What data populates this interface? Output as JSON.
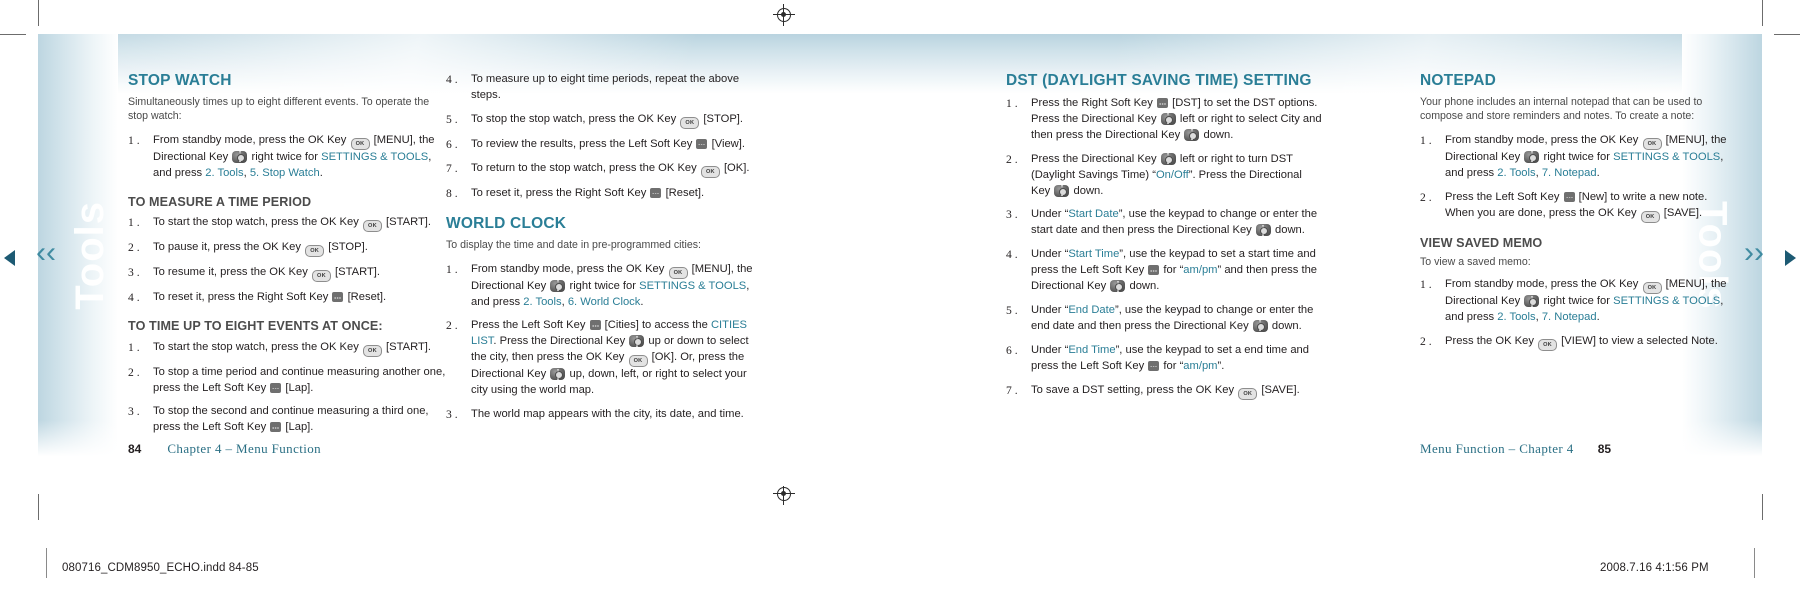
{
  "document": {
    "left_page_number": "84",
    "right_page_number": "85",
    "left_footer_text": "Chapter 4 – Menu Function",
    "right_footer_text": "Menu Function – Chapter 4",
    "slug_left": "080716_CDM8950_ECHO.indd   84-85",
    "slug_right": "2008.7.16   4:1:56 PM",
    "thumb_tab_label": "Tools",
    "accent_color": "#2a7e96",
    "body_color": "#231f20"
  },
  "icons": {
    "ok_key": "ok-key-icon",
    "soft_key": "soft-key-icon",
    "directional_key": "directional-key-icon",
    "registration_mark": "registration-mark-icon",
    "ok_label": "OK"
  },
  "columns": {
    "col1": {
      "section_title": "STOP WATCH",
      "intro": "Simultaneously times up to eight different events. To operate the stop watch:",
      "steps": [
        {
          "num": "1 .",
          "parts": [
            {
              "t": "text",
              "v": "From standby mode, press the OK Key "
            },
            {
              "t": "ok"
            },
            {
              "t": "text",
              "v": " [MENU], the Directional Key "
            },
            {
              "t": "dir"
            },
            {
              "t": "text",
              "v": " right twice for "
            },
            {
              "t": "link",
              "v": "SETTINGS & TOOLS"
            },
            {
              "t": "text",
              "v": ", and press "
            },
            {
              "t": "link",
              "v": "2. Tools"
            },
            {
              "t": "text",
              "v": ", "
            },
            {
              "t": "link",
              "v": "5. Stop Watch"
            },
            {
              "t": "text",
              "v": "."
            }
          ]
        }
      ],
      "sub1_title": "TO MEASURE A TIME PERIOD",
      "sub1_steps": [
        {
          "num": "1 .",
          "parts": [
            {
              "t": "text",
              "v": "To start the stop watch, press the OK Key "
            },
            {
              "t": "ok"
            },
            {
              "t": "text",
              "v": " [START]."
            }
          ]
        },
        {
          "num": "2 .",
          "parts": [
            {
              "t": "text",
              "v": "To pause it, press the OK Key "
            },
            {
              "t": "ok"
            },
            {
              "t": "text",
              "v": " [STOP]."
            }
          ]
        },
        {
          "num": "3 .",
          "parts": [
            {
              "t": "text",
              "v": "To resume it, press the OK Key "
            },
            {
              "t": "ok"
            },
            {
              "t": "text",
              "v": " [START]."
            }
          ]
        },
        {
          "num": "4 .",
          "parts": [
            {
              "t": "text",
              "v": "To reset it, press the Right Soft Key "
            },
            {
              "t": "soft"
            },
            {
              "t": "text",
              "v": " [Reset]."
            }
          ]
        }
      ],
      "sub2_title": "TO TIME UP TO EIGHT EVENTS AT ONCE:",
      "sub2_steps": [
        {
          "num": "1 .",
          "parts": [
            {
              "t": "text",
              "v": "To start the stop watch, press the OK Key "
            },
            {
              "t": "ok"
            },
            {
              "t": "text",
              "v": " [START]."
            }
          ]
        },
        {
          "num": "2 .",
          "parts": [
            {
              "t": "text",
              "v": "To stop a time period and continue measuring another one, press the Left Soft Key "
            },
            {
              "t": "soft"
            },
            {
              "t": "text",
              "v": " [Lap]."
            }
          ]
        },
        {
          "num": "3 .",
          "parts": [
            {
              "t": "text",
              "v": "To stop the second and continue measuring a third one, press the Left Soft Key "
            },
            {
              "t": "soft"
            },
            {
              "t": "text",
              "v": " [Lap]."
            }
          ]
        }
      ]
    },
    "col2": {
      "cont_steps": [
        {
          "num": "4 .",
          "parts": [
            {
              "t": "text",
              "v": "To measure up to eight time periods, repeat the above steps."
            }
          ]
        },
        {
          "num": "5 .",
          "parts": [
            {
              "t": "text",
              "v": "To stop the stop watch, press the OK Key "
            },
            {
              "t": "ok"
            },
            {
              "t": "text",
              "v": " [STOP]."
            }
          ]
        },
        {
          "num": "6 .",
          "parts": [
            {
              "t": "text",
              "v": "To review the results, press the Left Soft Key "
            },
            {
              "t": "soft"
            },
            {
              "t": "text",
              "v": " [View]."
            }
          ]
        },
        {
          "num": "7 .",
          "parts": [
            {
              "t": "text",
              "v": "To return to the stop watch, press the OK Key "
            },
            {
              "t": "ok"
            },
            {
              "t": "text",
              "v": " [OK]."
            }
          ]
        },
        {
          "num": "8 .",
          "parts": [
            {
              "t": "text",
              "v": "To reset it, press the Right Soft Key "
            },
            {
              "t": "soft"
            },
            {
              "t": "text",
              "v": " [Reset]."
            }
          ]
        }
      ],
      "section_title": "WORLD CLOCK",
      "intro": "To display the time and date in pre-programmed cities:",
      "steps": [
        {
          "num": "1 .",
          "parts": [
            {
              "t": "text",
              "v": "From standby mode, press the OK Key "
            },
            {
              "t": "ok"
            },
            {
              "t": "text",
              "v": " [MENU], the Directional Key "
            },
            {
              "t": "dir"
            },
            {
              "t": "text",
              "v": " right twice for "
            },
            {
              "t": "link",
              "v": "SETTINGS & TOOLS"
            },
            {
              "t": "text",
              "v": ", and press "
            },
            {
              "t": "link",
              "v": "2. Tools"
            },
            {
              "t": "text",
              "v": ", "
            },
            {
              "t": "link",
              "v": "6. World Clock"
            },
            {
              "t": "text",
              "v": "."
            }
          ]
        },
        {
          "num": "2 .",
          "parts": [
            {
              "t": "text",
              "v": "Press the Left Soft Key "
            },
            {
              "t": "soft"
            },
            {
              "t": "text",
              "v": " [Cities] to access the "
            },
            {
              "t": "link",
              "v": "CITIES LIST"
            },
            {
              "t": "text",
              "v": ". Press the Directional Key "
            },
            {
              "t": "dir"
            },
            {
              "t": "text",
              "v": " up or down to select the city, then press the OK Key "
            },
            {
              "t": "ok"
            },
            {
              "t": "text",
              "v": " [OK]. Or, press the Directional Key "
            },
            {
              "t": "dir"
            },
            {
              "t": "text",
              "v": " up, down, left, or right to select your city using the world map."
            }
          ]
        },
        {
          "num": "3 .",
          "parts": [
            {
              "t": "text",
              "v": "The world map appears with the city, its date, and time."
            }
          ]
        }
      ]
    },
    "col3": {
      "section_title": "DST (DAYLIGHT SAVING TIME) SETTING",
      "steps": [
        {
          "num": "1 .",
          "parts": [
            {
              "t": "text",
              "v": "Press the Right Soft Key "
            },
            {
              "t": "soft"
            },
            {
              "t": "text",
              "v": " [DST] to set the DST options. Press the Directional Key "
            },
            {
              "t": "dir"
            },
            {
              "t": "text",
              "v": " left or right to select City and then press the Directional Key "
            },
            {
              "t": "dir"
            },
            {
              "t": "text",
              "v": " down."
            }
          ]
        },
        {
          "num": "2 .",
          "parts": [
            {
              "t": "text",
              "v": "Press the Directional Key "
            },
            {
              "t": "dir"
            },
            {
              "t": "text",
              "v": " left or right to turn DST (Daylight Savings Time) “"
            },
            {
              "t": "link",
              "v": "On/Off"
            },
            {
              "t": "text",
              "v": "”. Press the Directional Key "
            },
            {
              "t": "dir"
            },
            {
              "t": "text",
              "v": " down."
            }
          ]
        },
        {
          "num": "3 .",
          "parts": [
            {
              "t": "text",
              "v": "Under “"
            },
            {
              "t": "link",
              "v": "Start Date"
            },
            {
              "t": "text",
              "v": "”, use the keypad to change or enter the start date and then press the Directional Key "
            },
            {
              "t": "dir"
            },
            {
              "t": "text",
              "v": " down."
            }
          ]
        },
        {
          "num": "4 .",
          "parts": [
            {
              "t": "text",
              "v": "Under “"
            },
            {
              "t": "link",
              "v": "Start Time"
            },
            {
              "t": "text",
              "v": "”, use the keypad to set a start time and press the Left Soft Key "
            },
            {
              "t": "soft"
            },
            {
              "t": "text",
              "v": " for “"
            },
            {
              "t": "link",
              "v": "am/pm"
            },
            {
              "t": "text",
              "v": "” and then press the Directional Key "
            },
            {
              "t": "dir"
            },
            {
              "t": "text",
              "v": " down."
            }
          ]
        },
        {
          "num": "5 .",
          "parts": [
            {
              "t": "text",
              "v": "Under “"
            },
            {
              "t": "link",
              "v": "End Date"
            },
            {
              "t": "text",
              "v": "”, use the keypad to change or enter the end date and then press the Directional Key "
            },
            {
              "t": "dir"
            },
            {
              "t": "text",
              "v": " down."
            }
          ]
        },
        {
          "num": "6 .",
          "parts": [
            {
              "t": "text",
              "v": "Under “"
            },
            {
              "t": "link",
              "v": "End Time"
            },
            {
              "t": "text",
              "v": "”, use the keypad to set a end time and press the Left Soft Key "
            },
            {
              "t": "soft"
            },
            {
              "t": "text",
              "v": " for “"
            },
            {
              "t": "link",
              "v": "am/pm"
            },
            {
              "t": "text",
              "v": "”."
            }
          ]
        },
        {
          "num": "7 .",
          "parts": [
            {
              "t": "text",
              "v": "To save a DST setting, press the OK Key "
            },
            {
              "t": "ok"
            },
            {
              "t": "text",
              "v": " [SAVE]."
            }
          ]
        }
      ]
    },
    "col4": {
      "section_title": "NOTEPAD",
      "intro": "Your phone includes an internal notepad that can be used to compose and store reminders and notes. To create a note:",
      "steps": [
        {
          "num": "1 .",
          "parts": [
            {
              "t": "text",
              "v": "From standby mode, press the OK Key "
            },
            {
              "t": "ok"
            },
            {
              "t": "text",
              "v": " [MENU], the Directional Key "
            },
            {
              "t": "dir"
            },
            {
              "t": "text",
              "v": " right twice for "
            },
            {
              "t": "link",
              "v": "SETTINGS & TOOLS"
            },
            {
              "t": "text",
              "v": ", and press "
            },
            {
              "t": "link",
              "v": "2. Tools"
            },
            {
              "t": "text",
              "v": ", "
            },
            {
              "t": "link",
              "v": "7. Notepad"
            },
            {
              "t": "text",
              "v": "."
            }
          ]
        },
        {
          "num": "2 .",
          "parts": [
            {
              "t": "text",
              "v": "Press the Left Soft Key "
            },
            {
              "t": "soft"
            },
            {
              "t": "text",
              "v": " [New] to write a new note. When you are done, press the OK Key "
            },
            {
              "t": "ok"
            },
            {
              "t": "text",
              "v": " [SAVE]."
            }
          ]
        }
      ],
      "sub1_title": "VIEW SAVED MEMO",
      "sub1_intro": "To view a saved memo:",
      "sub1_steps": [
        {
          "num": "1 .",
          "parts": [
            {
              "t": "text",
              "v": "From standby mode, press the OK Key "
            },
            {
              "t": "ok"
            },
            {
              "t": "text",
              "v": " [MENU], the Directional Key "
            },
            {
              "t": "dir"
            },
            {
              "t": "text",
              "v": " right twice for "
            },
            {
              "t": "link",
              "v": "SETTINGS & TOOLS"
            },
            {
              "t": "text",
              "v": ", and press "
            },
            {
              "t": "link",
              "v": "2. Tools"
            },
            {
              "t": "text",
              "v": ", "
            },
            {
              "t": "link",
              "v": "7. Notepad"
            },
            {
              "t": "text",
              "v": "."
            }
          ]
        },
        {
          "num": "2 .",
          "parts": [
            {
              "t": "text",
              "v": "Press the OK Key "
            },
            {
              "t": "ok"
            },
            {
              "t": "text",
              "v": " [VIEW] to view a selected Note."
            }
          ]
        }
      ]
    }
  }
}
